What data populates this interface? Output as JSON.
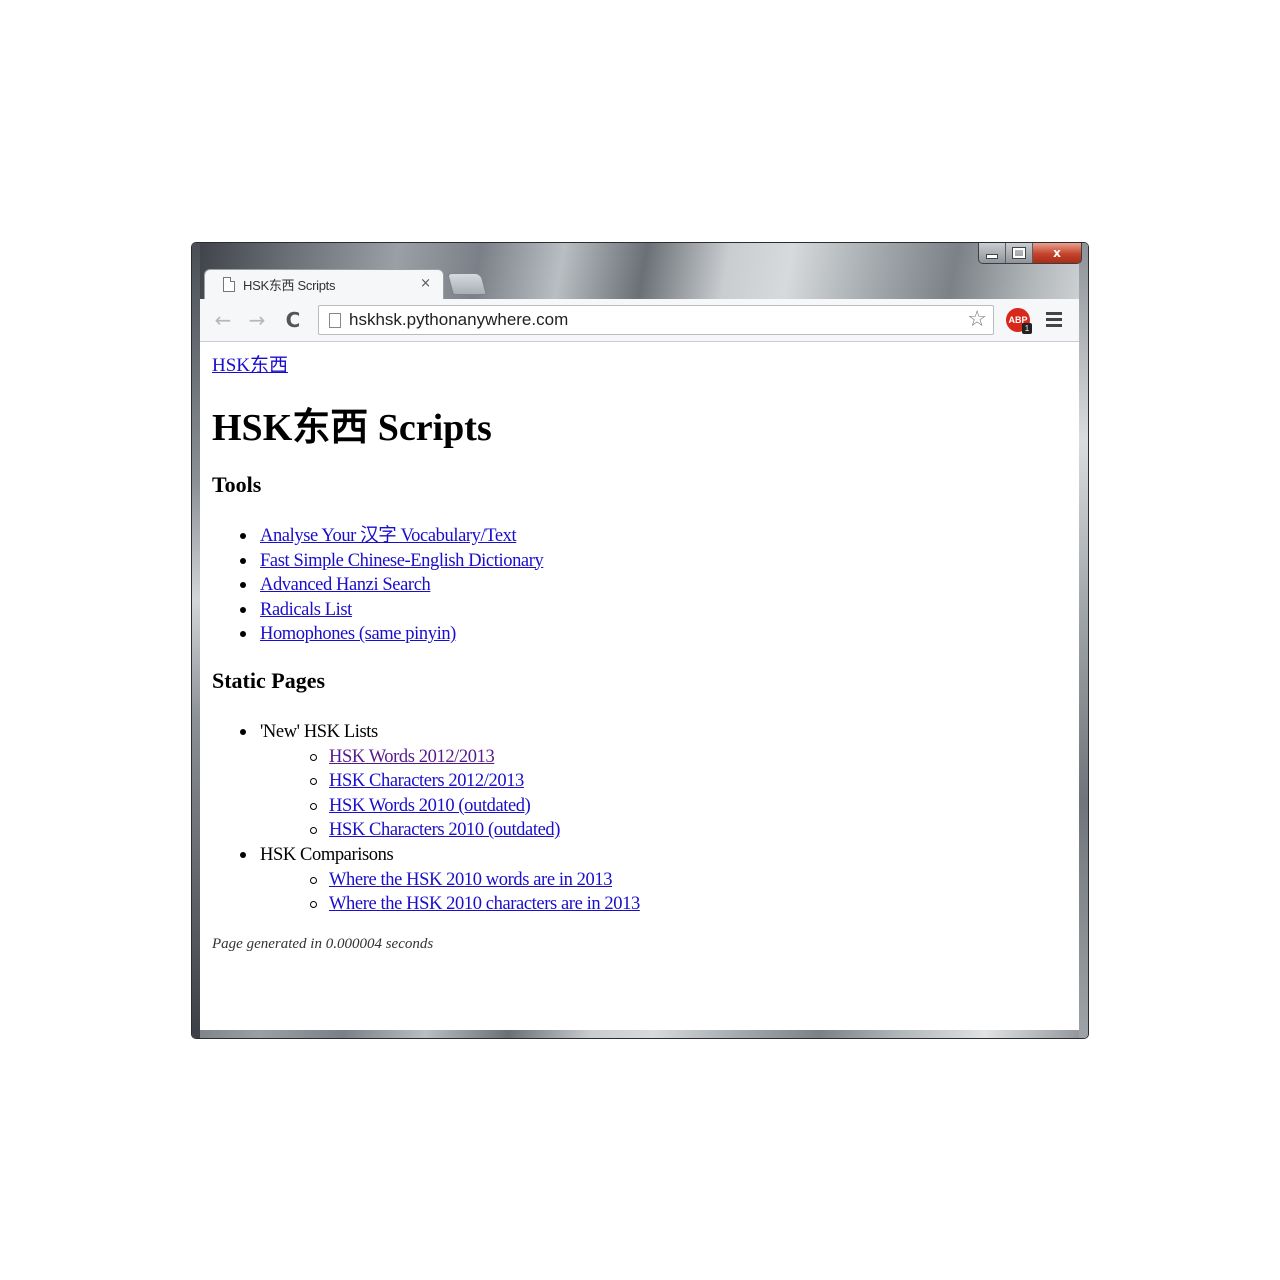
{
  "window": {
    "tab_title": "HSK东西 Scripts",
    "tab_close": "×",
    "caption": {
      "minimize": "",
      "maximize": "",
      "close": "x"
    }
  },
  "toolbar": {
    "back": "←",
    "forward": "→",
    "reload": "C",
    "url": "hskhsk.pythonanywhere.com",
    "star": "☆",
    "adblock_label": "ABP",
    "adblock_badge": "1"
  },
  "page": {
    "home_link": "HSK东西",
    "title": "HSK东西 Scripts",
    "tools_heading": "Tools",
    "tools": [
      "Analyse Your 汉字 Vocabulary/Text",
      "Fast Simple Chinese-English Dictionary",
      "Advanced Hanzi Search",
      "Radicals List",
      "Homophones (same pinyin)"
    ],
    "static_heading": "Static Pages",
    "static_groups": [
      {
        "label": "'New' HSK Lists",
        "links": [
          "HSK Words 2012/2013",
          "HSK Characters 2012/2013",
          "HSK Words 2010 (outdated)",
          "HSK Characters 2010 (outdated)"
        ]
      },
      {
        "label": "HSK Comparisons",
        "links": [
          "Where the HSK 2010 words are in 2013",
          "Where the HSK 2010 characters are in 2013"
        ]
      }
    ],
    "footer": "Page generated in 0.000004 seconds"
  },
  "colors": {
    "link": "#1a0dcc",
    "visited_link": "#551a8b",
    "adblock": "#d8281c"
  }
}
